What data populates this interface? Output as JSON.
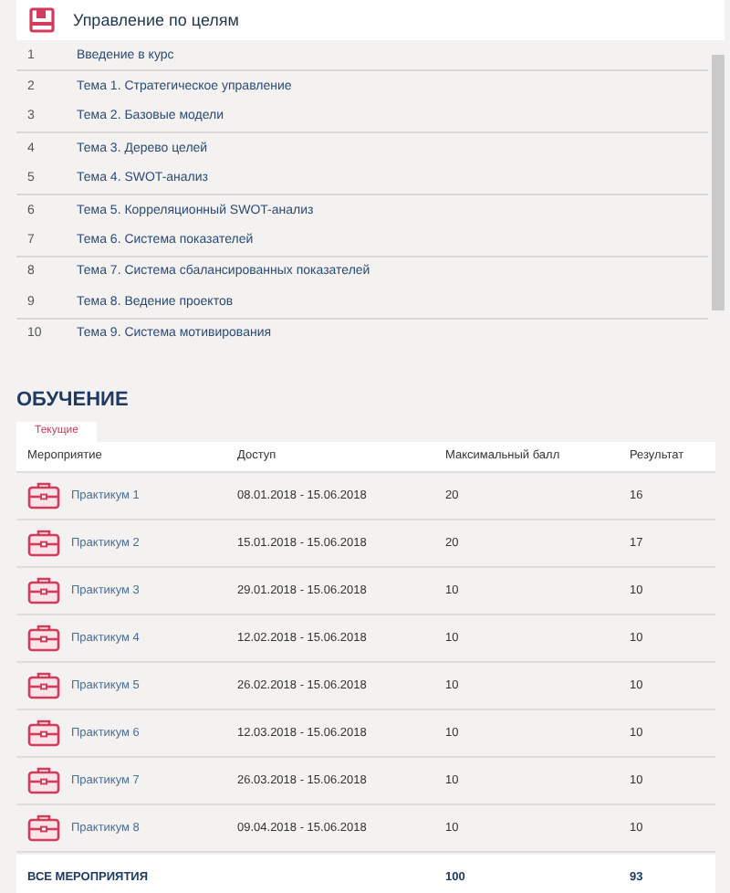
{
  "course": {
    "title": "Управление по целям",
    "lessons": [
      {
        "number": "1",
        "title": "Введение в курс"
      },
      {
        "number": "2",
        "title": "Тема 1. Стратегическое управление"
      },
      {
        "number": "3",
        "title": "Тема 2. Базовые модели"
      },
      {
        "number": "4",
        "title": "Тема 3. Дерево целей"
      },
      {
        "number": "5",
        "title": "Тема 4. SWOT-анализ"
      },
      {
        "number": "6",
        "title": "Тема 5. Корреляционный SWOT-анализ"
      },
      {
        "number": "7",
        "title": "Тема 6. Система показателей"
      },
      {
        "number": "8",
        "title": "Тема 7. Система сбалансированных показателей"
      },
      {
        "number": "9",
        "title": "Тема 8. Ведение проектов"
      },
      {
        "number": "10",
        "title": "Тема 9. Система мотивирования"
      }
    ]
  },
  "training": {
    "heading": "ОБУЧЕНИЕ",
    "tabs": [
      {
        "label": "Текущие",
        "selected": true
      }
    ],
    "columns": [
      "Мероприятие",
      "Доступ",
      "Максимальный балл",
      "Результат"
    ],
    "rows": [
      {
        "name": "Практикум 1",
        "access": "08.01.2018 - 15.06.2018",
        "max": "20",
        "result": "16"
      },
      {
        "name": "Практикум 2",
        "access": "15.01.2018 - 15.06.2018",
        "max": "20",
        "result": "17"
      },
      {
        "name": "Практикум 3",
        "access": "29.01.2018 - 15.06.2018",
        "max": "10",
        "result": "10"
      },
      {
        "name": "Практикум 4",
        "access": "12.02.2018 - 15.06.2018",
        "max": "10",
        "result": "10"
      },
      {
        "name": "Практикум 5",
        "access": "26.02.2018 - 15.06.2018",
        "max": "10",
        "result": "10"
      },
      {
        "name": "Практикум 6",
        "access": "12.03.2018 - 15.06.2018",
        "max": "10",
        "result": "10"
      },
      {
        "name": "Практикум 7",
        "access": "26.03.2018 - 15.06.2018",
        "max": "10",
        "result": "10"
      },
      {
        "name": "Практикум 8",
        "access": "09.04.2018 - 15.06.2018",
        "max": "10",
        "result": "10"
      }
    ],
    "total": {
      "label": "ВСЕ МЕРОПРИЯТИЯ",
      "max": "100",
      "result": "93"
    }
  }
}
